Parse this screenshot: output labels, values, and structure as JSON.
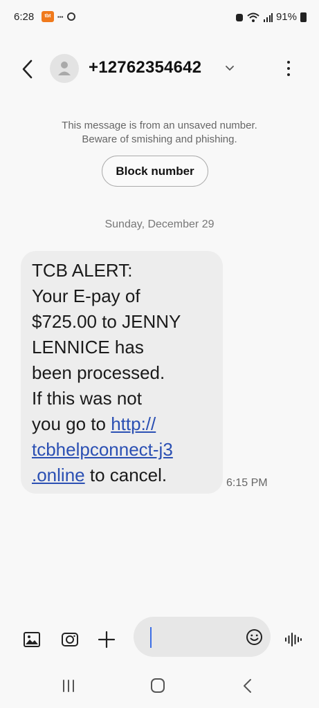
{
  "status_bar": {
    "time": "6:28",
    "battery": "91%",
    "notification_badge": "tbt"
  },
  "header": {
    "contact": "+12762354642",
    "icons": [
      "back-arrow-icon",
      "contact-avatar-icon",
      "chevron-down-icon",
      "more-vertical-icon"
    ]
  },
  "warning": {
    "line1": "This message is from an unsaved number.",
    "line2": "Beware of smishing and phishing.",
    "block_label": "Block number"
  },
  "conversation": {
    "date": "Sunday, December 29",
    "message": {
      "lines": [
        "TCB  ALERT:",
        "Your E-pay of",
        "$725.00 to JENNY",
        "LENNICE has",
        "been processed.",
        "If this was not"
      ],
      "line7_prefix": "you go to ",
      "link_part1": "http://",
      "link_part2": "tcbhelpconnect-j3",
      "link_part3": ".online",
      "line9_suffix": " to cancel.",
      "time": "6:15 PM",
      "link_color": "#2a4fb3"
    }
  },
  "composer": {
    "icons": [
      "gallery-icon",
      "camera-icon",
      "add-icon",
      "emoji-icon",
      "voice-icon"
    ],
    "accent": "#3b6ee6"
  },
  "nav_bar": {
    "icons": [
      "recents-icon",
      "home-icon",
      "back-icon"
    ]
  }
}
